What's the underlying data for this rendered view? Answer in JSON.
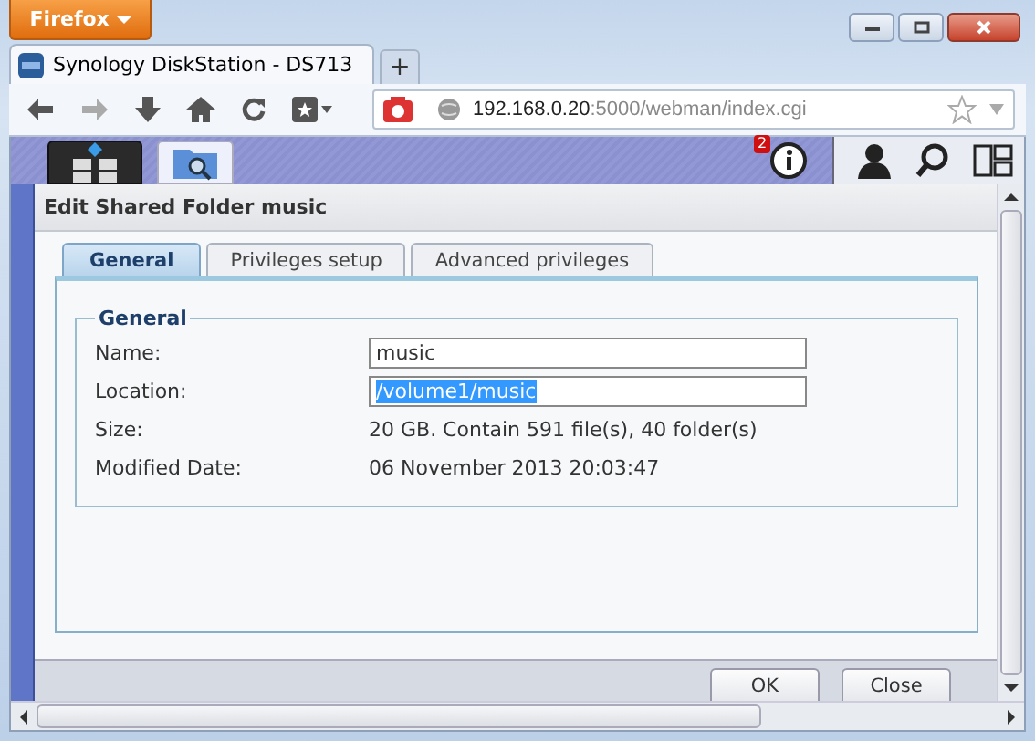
{
  "browser": {
    "menu_button": "Firefox",
    "tabs": [
      {
        "title": "Synology DiskStation - DS713",
        "selected": true
      }
    ],
    "new_tab": "+",
    "url": {
      "host": "192.168.0.20",
      "rest": ":5000/webman/index.cgi"
    }
  },
  "taskbar": {
    "notification_count": "2"
  },
  "dialog": {
    "title": "Edit Shared Folder music",
    "tabs": [
      {
        "label": "General",
        "selected": true
      },
      {
        "label": "Privileges setup",
        "selected": false
      },
      {
        "label": "Advanced privileges",
        "selected": false
      }
    ],
    "group_title": "General",
    "fields": [
      {
        "kind": "input",
        "label": "Name:",
        "value": "music",
        "selected": false
      },
      {
        "kind": "input",
        "label": "Location:",
        "value": "/volume1/music",
        "selected": true
      },
      {
        "kind": "text",
        "label": "Size:",
        "value": "20 GB. Contain 591 file(s), 40 folder(s)"
      },
      {
        "kind": "text",
        "label": "Modified Date:",
        "value": "06 November 2013 20:03:47"
      }
    ],
    "buttons": [
      "OK",
      "Close"
    ]
  }
}
